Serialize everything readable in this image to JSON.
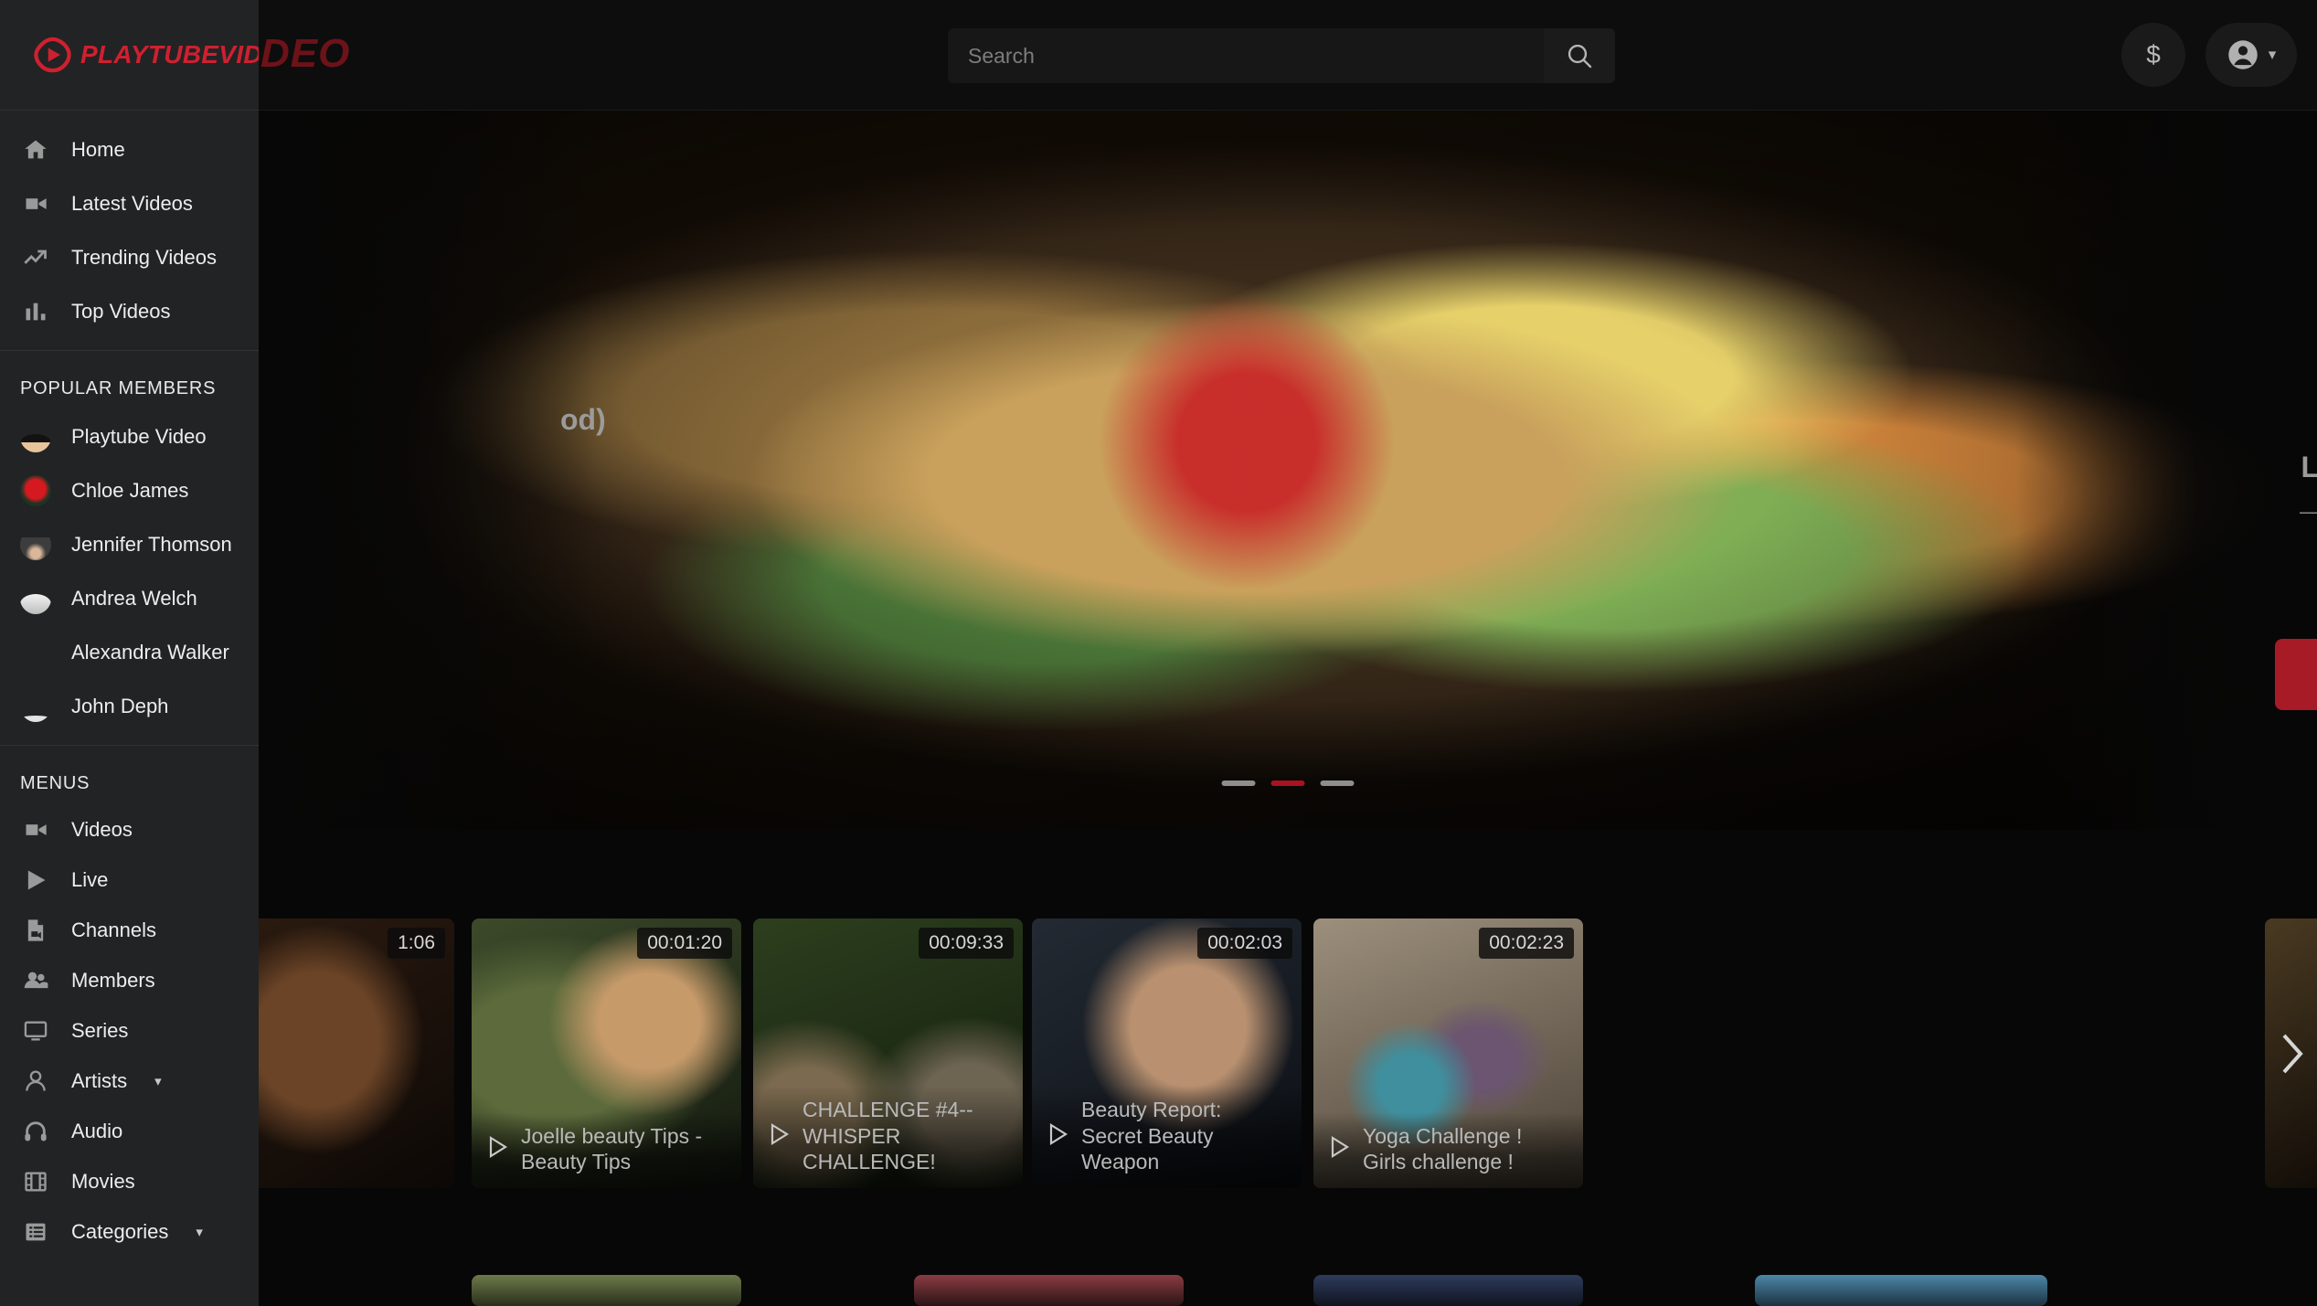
{
  "brand": {
    "name": "PLAYTUBEVIDEO",
    "accent": "#cf2030",
    "bg_logo": "DEO"
  },
  "header": {
    "search_placeholder": "Search",
    "search_value": "",
    "search_icon": "search-icon",
    "money_label": "$",
    "account_icon": "account-circle-icon",
    "account_caret": "▾"
  },
  "sidebar": {
    "nav": [
      {
        "label": "Home",
        "icon": "home-icon"
      },
      {
        "label": "Latest Videos",
        "icon": "videocam-icon"
      },
      {
        "label": "Trending Videos",
        "icon": "trending-up-icon"
      },
      {
        "label": "Top Videos",
        "icon": "bar-chart-icon"
      }
    ],
    "members_title": "POPULAR MEMBERS",
    "members": [
      {
        "name": "Playtube Video",
        "avatar": "avatar-playtube-video"
      },
      {
        "name": "Chloe James",
        "avatar": "avatar-chloe-james"
      },
      {
        "name": "Jennifer Thomson",
        "avatar": "avatar-jennifer-thomson"
      },
      {
        "name": "Andrea Welch",
        "avatar": "avatar-andrea-welch"
      },
      {
        "name": "Alexandra Walker",
        "avatar": "avatar-alexandra-walker"
      },
      {
        "name": "John Deph",
        "avatar": "avatar-john-deph"
      }
    ],
    "menus_title": "MENUS",
    "menus": [
      {
        "label": "Videos",
        "icon": "videocam-icon",
        "caret": ""
      },
      {
        "label": "Live",
        "icon": "play-icon",
        "caret": ""
      },
      {
        "label": "Channels",
        "icon": "file-video-icon",
        "caret": ""
      },
      {
        "label": "Members",
        "icon": "people-icon",
        "caret": ""
      },
      {
        "label": "Series",
        "icon": "monitor-icon",
        "caret": ""
      },
      {
        "label": "Artists",
        "icon": "person-icon",
        "caret": "▾"
      },
      {
        "label": "Audio",
        "icon": "headphones-icon",
        "caret": ""
      },
      {
        "label": "Movies",
        "icon": "film-icon",
        "caret": ""
      },
      {
        "label": "Categories",
        "icon": "list-icon",
        "caret": "▾"
      }
    ]
  },
  "hero": {
    "title_fragment": "od)",
    "right_fragment": "L",
    "slides_total": 3,
    "active_slide": 2
  },
  "carousel": {
    "next_icon": "chevron-right-icon",
    "play_icon": "play-icon",
    "cards": [
      {
        "title": "",
        "duration": "1:06",
        "partial": true
      },
      {
        "title": "Joelle beauty Tips - Beauty Tips",
        "duration": "00:01:20",
        "partial": false
      },
      {
        "title": "CHALLENGE #4--WHISPER CHALLENGE!",
        "duration": "00:09:33",
        "partial": false
      },
      {
        "title": "Beauty Report: Secret Beauty Weapon",
        "duration": "00:02:03",
        "partial": false
      },
      {
        "title": "Yoga Challenge ! Girls challenge !",
        "duration": "00:02:23",
        "partial": false
      },
      {
        "title": "",
        "duration": "",
        "partial": true
      }
    ]
  }
}
